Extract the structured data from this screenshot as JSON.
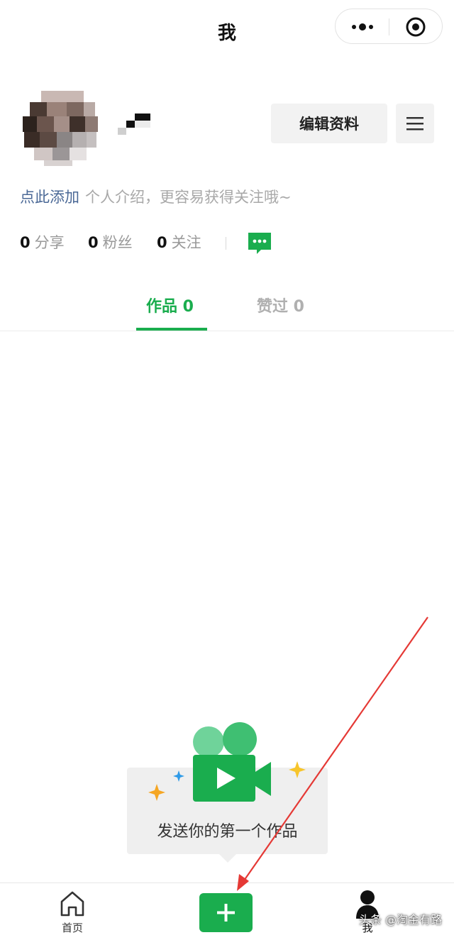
{
  "header": {
    "title": "我"
  },
  "capsule": {
    "more_icon": "more-dots-icon",
    "close_icon": "target-circle-icon"
  },
  "profile": {
    "edit_label": "编辑资料",
    "menu_icon": "hamburger-icon",
    "bio_link": "点此添加",
    "bio_hint": "个人介绍，更容易获得关注哦~"
  },
  "stats": [
    {
      "num": "0",
      "label": "分享"
    },
    {
      "num": "0",
      "label": "粉丝"
    },
    {
      "num": "0",
      "label": "关注"
    }
  ],
  "tabs": [
    {
      "label": "作品 0",
      "active": true
    },
    {
      "label": "赞过 0",
      "active": false
    }
  ],
  "empty": {
    "text": "发送你的第一个作品"
  },
  "tabbar": {
    "home_label": "首页",
    "me_label": "我"
  },
  "watermark": "头条 @淘金有路",
  "colors": {
    "accent": "#1aad4e",
    "link": "#4a6896",
    "annotation_arrow": "#e53935"
  }
}
